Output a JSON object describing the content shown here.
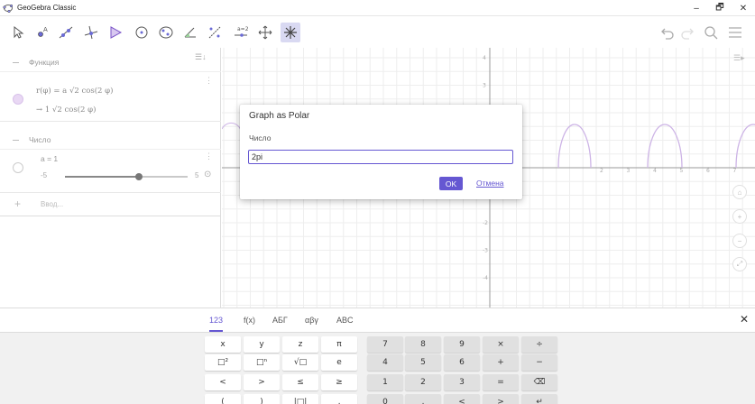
{
  "window": {
    "title": "GeoGebra Classic",
    "controls": [
      "–",
      "🗗",
      "✕"
    ]
  },
  "toolbar": {
    "tools": [
      {
        "name": "move-tool-icon"
      },
      {
        "name": "point-tool-icon"
      },
      {
        "name": "line-tool-icon"
      },
      {
        "name": "perpendicular-tool-icon"
      },
      {
        "name": "polygon-tool-icon"
      },
      {
        "name": "circle-tool-icon"
      },
      {
        "name": "conic-tool-icon"
      },
      {
        "name": "angle-tool-icon"
      },
      {
        "name": "reflect-tool-icon"
      },
      {
        "name": "slider-tool-icon"
      },
      {
        "name": "move-view-tool-icon"
      },
      {
        "name": "custom-tool-icon"
      }
    ],
    "right": [
      "undo-icon",
      "redo-icon",
      "search-icon",
      "menu-icon"
    ]
  },
  "algebra": {
    "sections": [
      {
        "label": "Функция"
      },
      {
        "label": "Число"
      }
    ],
    "function_row": {
      "line1": "r(φ) = a √2 cos(2 φ)",
      "line2": "→ 1 √2 cos(2 φ)"
    },
    "slider_row": {
      "label": "a = 1",
      "min": "-5",
      "max": "5",
      "value_fraction": 0.6
    },
    "input_placeholder": "Ввод..."
  },
  "graphics": {
    "x_ticks": [
      "2",
      "3",
      "4",
      "5",
      "6",
      "7",
      "8",
      "9"
    ],
    "y_ticks": [
      "4",
      "3",
      "-2",
      "-3",
      "-4"
    ],
    "y_axis_label_top": "4"
  },
  "dialog": {
    "title": "Graph as Polar",
    "field_label": "Число",
    "input_value": "2pi",
    "ok_label": "OK",
    "cancel_label": "Отмена"
  },
  "keyboard": {
    "tabs": [
      "123",
      "f(x)",
      "АБГ",
      "αβγ",
      "ABC"
    ],
    "active_tab": "123",
    "close": "✕",
    "rows": [
      [
        "x",
        "y",
        "z",
        "π",
        "7",
        "8",
        "9",
        "×",
        "÷"
      ],
      [
        "□²",
        "□ⁿ",
        "√□",
        "e",
        "4",
        "5",
        "6",
        "+",
        "−"
      ],
      [
        "<",
        ">",
        "≤",
        "≥",
        "1",
        "2",
        "3",
        "=",
        "⌫"
      ],
      [
        "(",
        ")",
        "|□|",
        ",",
        "0",
        ".",
        "<",
        ">",
        "↵"
      ]
    ]
  },
  "colors": {
    "accent": "#6557d2",
    "function_marble": "#e9d8f4"
  }
}
